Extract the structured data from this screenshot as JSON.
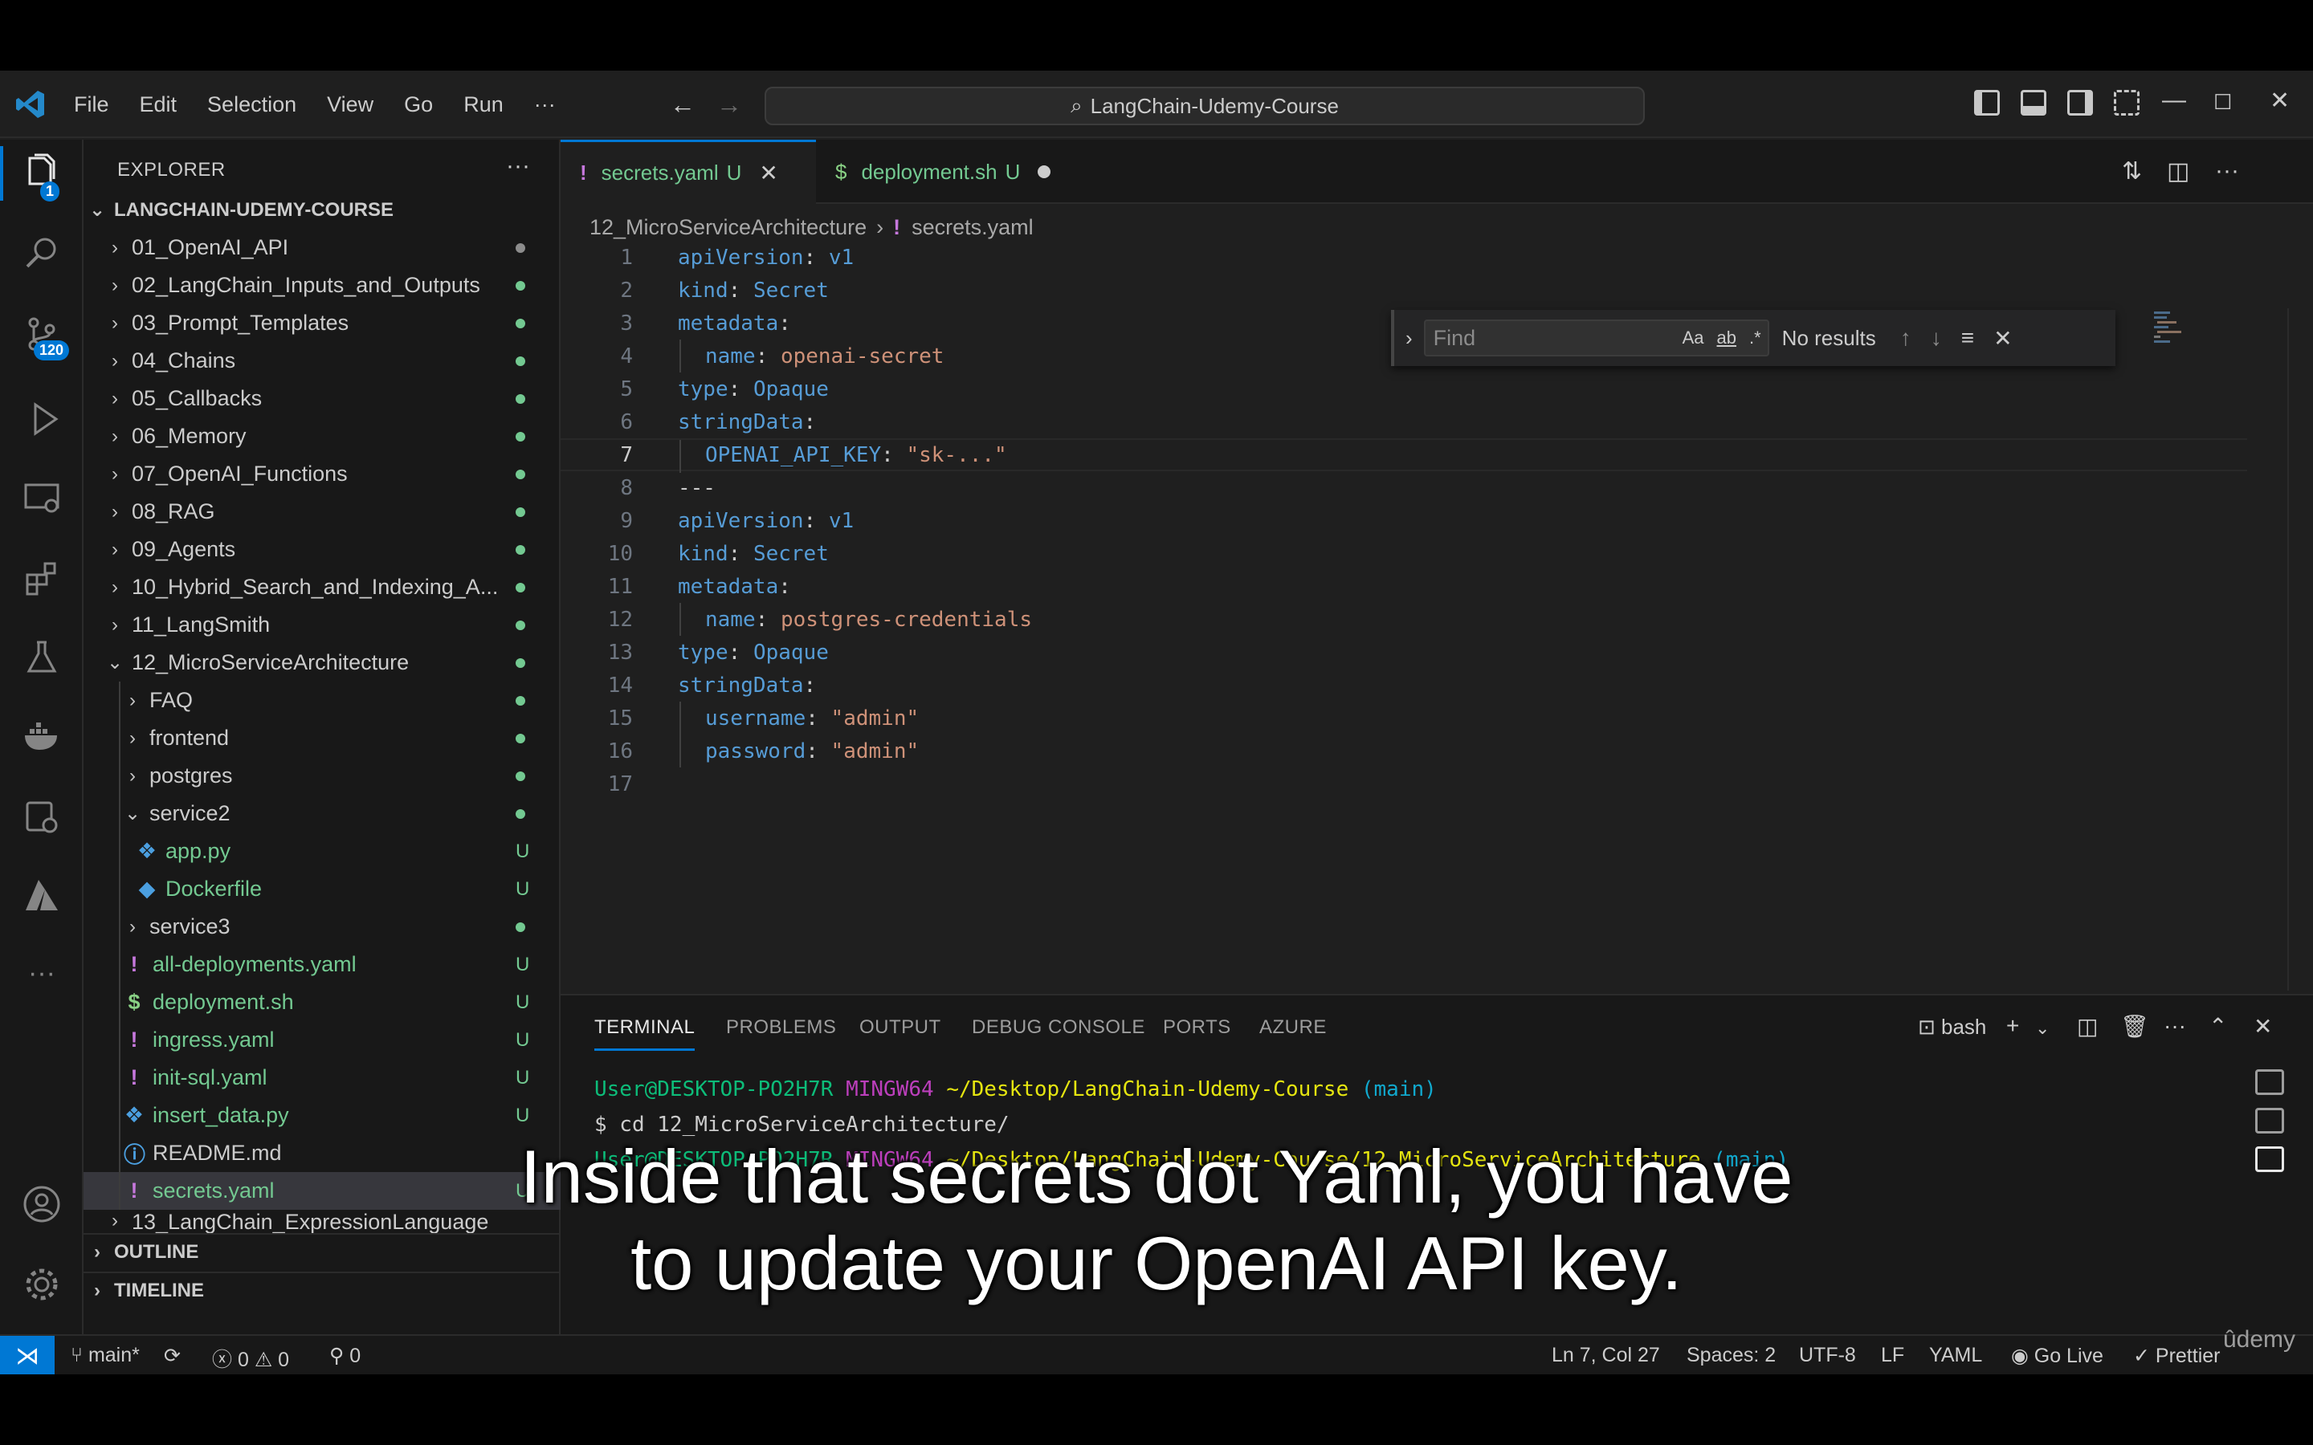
{
  "titlebar": {
    "menu": [
      "File",
      "Edit",
      "Selection",
      "View",
      "Go",
      "Run",
      "···"
    ],
    "search": "LangChain-Udemy-Course"
  },
  "activity": {
    "explorer_badge": "1",
    "scm_badge": "120"
  },
  "sidebar": {
    "title": "EXPLORER",
    "more": "···",
    "root": "LANGCHAIN-UDEMY-COURSE",
    "items": [
      {
        "label": "01_OpenAI_API",
        "status": "dot"
      },
      {
        "label": "02_LangChain_Inputs_and_Outputs",
        "status": "dot"
      },
      {
        "label": "03_Prompt_Templates",
        "status": "dot"
      },
      {
        "label": "04_Chains",
        "status": "dot"
      },
      {
        "label": "05_Callbacks",
        "status": "dot"
      },
      {
        "label": "06_Memory",
        "status": "dot"
      },
      {
        "label": "07_OpenAI_Functions",
        "status": "dot"
      },
      {
        "label": "08_RAG",
        "status": "dot"
      },
      {
        "label": "09_Agents",
        "status": "dot"
      },
      {
        "label": "10_Hybrid_Search_and_Indexing_A...",
        "status": "dot"
      },
      {
        "label": "11_LangSmith",
        "status": "dot"
      },
      {
        "label": "12_MicroServiceArchitecture",
        "status": "dot"
      },
      {
        "label": "FAQ",
        "status": "dot"
      },
      {
        "label": "frontend",
        "status": "dot"
      },
      {
        "label": "postgres",
        "status": "dot"
      },
      {
        "label": "service2",
        "status": "dot"
      },
      {
        "label": "app.py",
        "status": "U"
      },
      {
        "label": "Dockerfile",
        "status": "U"
      },
      {
        "label": "service3",
        "status": "dot"
      },
      {
        "label": "all-deployments.yaml",
        "status": "U"
      },
      {
        "label": "deployment.sh",
        "status": "U"
      },
      {
        "label": "ingress.yaml",
        "status": "U"
      },
      {
        "label": "init-sql.yaml",
        "status": "U"
      },
      {
        "label": "insert_data.py",
        "status": "U"
      },
      {
        "label": "README.md",
        "status": ""
      },
      {
        "label": "secrets.yaml",
        "status": "U"
      },
      {
        "label": "13_LangChain_ExpressionLanguage",
        "status": "dot"
      }
    ],
    "outline": "OUTLINE",
    "timeline": "TIMELINE"
  },
  "editor": {
    "tabs": [
      {
        "label": "secrets.yaml",
        "status": "U",
        "icon": "!"
      },
      {
        "label": "deployment.sh",
        "status": "U",
        "icon": "$"
      }
    ],
    "breadcrumb": [
      "12_MicroServiceArchitecture",
      "secrets.yaml"
    ],
    "lines": [
      {
        "n": "1",
        "indent": 0,
        "key": "apiVersion",
        "val": "v1",
        "vtype": "k"
      },
      {
        "n": "2",
        "indent": 0,
        "key": "kind",
        "val": "Secret",
        "vtype": "k"
      },
      {
        "n": "3",
        "indent": 0,
        "key": "metadata",
        "val": "",
        "vtype": "k"
      },
      {
        "n": "4",
        "indent": 1,
        "key": "name",
        "val": "openai-secret",
        "vtype": "s"
      },
      {
        "n": "5",
        "indent": 0,
        "key": "type",
        "val": "Opaque",
        "vtype": "k"
      },
      {
        "n": "6",
        "indent": 0,
        "key": "stringData",
        "val": "",
        "vtype": "k"
      },
      {
        "n": "7",
        "indent": 1,
        "key": "OPENAI_API_KEY",
        "val": "\"sk-...\"",
        "vtype": "s"
      },
      {
        "n": "8",
        "indent": 0,
        "key": "",
        "val": "---",
        "vtype": "p"
      },
      {
        "n": "9",
        "indent": 0,
        "key": "apiVersion",
        "val": "v1",
        "vtype": "k"
      },
      {
        "n": "10",
        "indent": 0,
        "key": "kind",
        "val": "Secret",
        "vtype": "k"
      },
      {
        "n": "11",
        "indent": 0,
        "key": "metadata",
        "val": "",
        "vtype": "k"
      },
      {
        "n": "12",
        "indent": 1,
        "key": "name",
        "val": "postgres-credentials",
        "vtype": "s"
      },
      {
        "n": "13",
        "indent": 0,
        "key": "type",
        "val": "Opaque",
        "vtype": "k"
      },
      {
        "n": "14",
        "indent": 0,
        "key": "stringData",
        "val": "",
        "vtype": "k"
      },
      {
        "n": "15",
        "indent": 1,
        "key": "username",
        "val": "\"admin\"",
        "vtype": "s"
      },
      {
        "n": "16",
        "indent": 1,
        "key": "password",
        "val": "\"admin\"",
        "vtype": "s"
      },
      {
        "n": "17",
        "indent": 0,
        "key": "",
        "val": "",
        "vtype": "p"
      }
    ],
    "find": {
      "placeholder": "Find",
      "result": "No results",
      "opt_case": "Aa",
      "opt_word": "ab",
      "opt_regex": ".*"
    }
  },
  "panel": {
    "tabs": [
      "TERMINAL",
      "PROBLEMS",
      "OUTPUT",
      "DEBUG CONSOLE",
      "PORTS",
      "AZURE"
    ],
    "shell": "bash",
    "term_lines": [
      {
        "user": "User@DESKTOP-PO2H7R ",
        "sys": "MINGW64 ",
        "path": "~/Desktop/LangChain-Udemy-Course ",
        "branch": "(main)"
      },
      {
        "user": "$ cd 12_MicroServiceArchitecture/",
        "sys": "",
        "path": "",
        "branch": ""
      },
      {
        "user": "User@DESKTOP-PO2H7R ",
        "sys": "MINGW64 ",
        "path": "~/Desktop/LangChain-Udemy-Course/12_MicroServiceArchitecture ",
        "branch": "(main)"
      }
    ]
  },
  "statusbar": {
    "branch": "main*",
    "errors": "0",
    "warnings": "0",
    "ports": "0",
    "position": "Ln 7, Col 27",
    "spaces": "Spaces: 2",
    "encoding": "UTF-8",
    "eol": "LF",
    "language": "YAML",
    "golive": "Go Live",
    "prettier": "Prettier"
  },
  "subtitle": {
    "line1": "Inside that secrets dot Yaml, you have",
    "line2": "to update your OpenAI API key."
  },
  "watermark": "ûdemy"
}
